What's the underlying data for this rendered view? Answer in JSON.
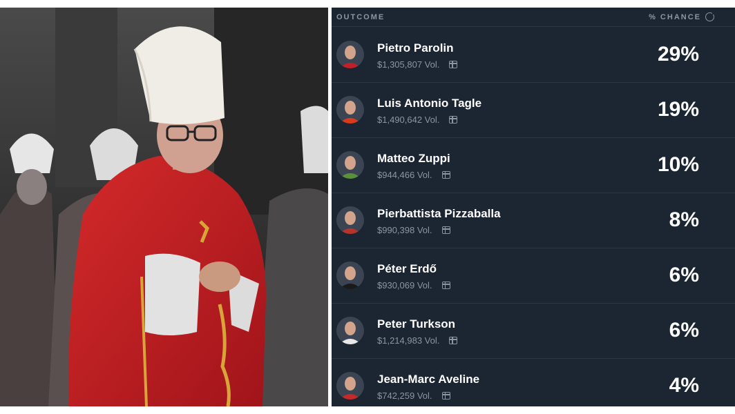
{
  "header": {
    "outcome_label": "OUTCOME",
    "chance_label": "% CHANCE"
  },
  "vol_suffix": "Vol.",
  "candidates": [
    {
      "name": "Pietro Parolin",
      "volume": "$1,305,807",
      "chance": "29%",
      "avatar_color": "#c0202a"
    },
    {
      "name": "Luis Antonio Tagle",
      "volume": "$1,490,642",
      "chance": "19%",
      "avatar_color": "#d93a1c"
    },
    {
      "name": "Matteo Zuppi",
      "volume": "$944,466",
      "chance": "10%",
      "avatar_color": "#5b8f3a"
    },
    {
      "name": "Pierbattista Pizzaballa",
      "volume": "$990,398",
      "chance": "8%",
      "avatar_color": "#b8342a"
    },
    {
      "name": "Péter Erdő",
      "volume": "$930,069",
      "chance": "6%",
      "avatar_color": "#1a1a1a"
    },
    {
      "name": "Peter Turkson",
      "volume": "$1,214,983",
      "chance": "6%",
      "avatar_color": "#e8e8e8"
    },
    {
      "name": "Jean-Marc Aveline",
      "volume": "$742,259",
      "chance": "4%",
      "avatar_color": "#c42a2a"
    }
  ],
  "colors": {
    "panel_bg": "#1c2532",
    "muted_text": "#8b96a5",
    "divider": "#2b3645",
    "vestment_red": "#c21f1f"
  }
}
